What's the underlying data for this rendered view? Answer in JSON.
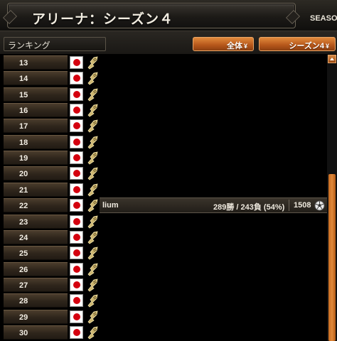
{
  "header": {
    "title": "アリーナ：シーズン４",
    "season_tab": "SEASO"
  },
  "filters": {
    "ranking_label": "ランキング",
    "scope_dropdown": "全体",
    "season_dropdown": "シーズン4",
    "arrow_icon": "chevron-double-down-icon"
  },
  "rows": [
    {
      "rank": "13",
      "flag": "japan-flag-icon"
    },
    {
      "rank": "14",
      "flag": "japan-flag-icon"
    },
    {
      "rank": "15",
      "flag": "japan-flag-icon"
    },
    {
      "rank": "16",
      "flag": "japan-flag-icon"
    },
    {
      "rank": "17",
      "flag": "japan-flag-icon"
    },
    {
      "rank": "18",
      "flag": "japan-flag-icon"
    },
    {
      "rank": "19",
      "flag": "japan-flag-icon"
    },
    {
      "rank": "20",
      "flag": "japan-flag-icon"
    },
    {
      "rank": "21",
      "flag": "japan-flag-icon"
    },
    {
      "rank": "22",
      "flag": "japan-flag-icon"
    },
    {
      "rank": "23",
      "flag": "japan-flag-icon"
    },
    {
      "rank": "24",
      "flag": "japan-flag-icon"
    },
    {
      "rank": "25",
      "flag": "japan-flag-icon"
    },
    {
      "rank": "26",
      "flag": "japan-flag-icon"
    },
    {
      "rank": "27",
      "flag": "japan-flag-icon"
    },
    {
      "rank": "28",
      "flag": "japan-flag-icon"
    },
    {
      "rank": "29",
      "flag": "japan-flag-icon"
    },
    {
      "rank": "30",
      "flag": "japan-flag-icon"
    }
  ],
  "highlight": {
    "name": "lium",
    "record": "289勝 / 243負 (54%)",
    "rating": "1508",
    "icon": "soccer-ball-icon"
  },
  "colors": {
    "accent_orange": "#d0702a",
    "flag_red": "#d4000f",
    "emblem_gold": "#d8c27a"
  }
}
